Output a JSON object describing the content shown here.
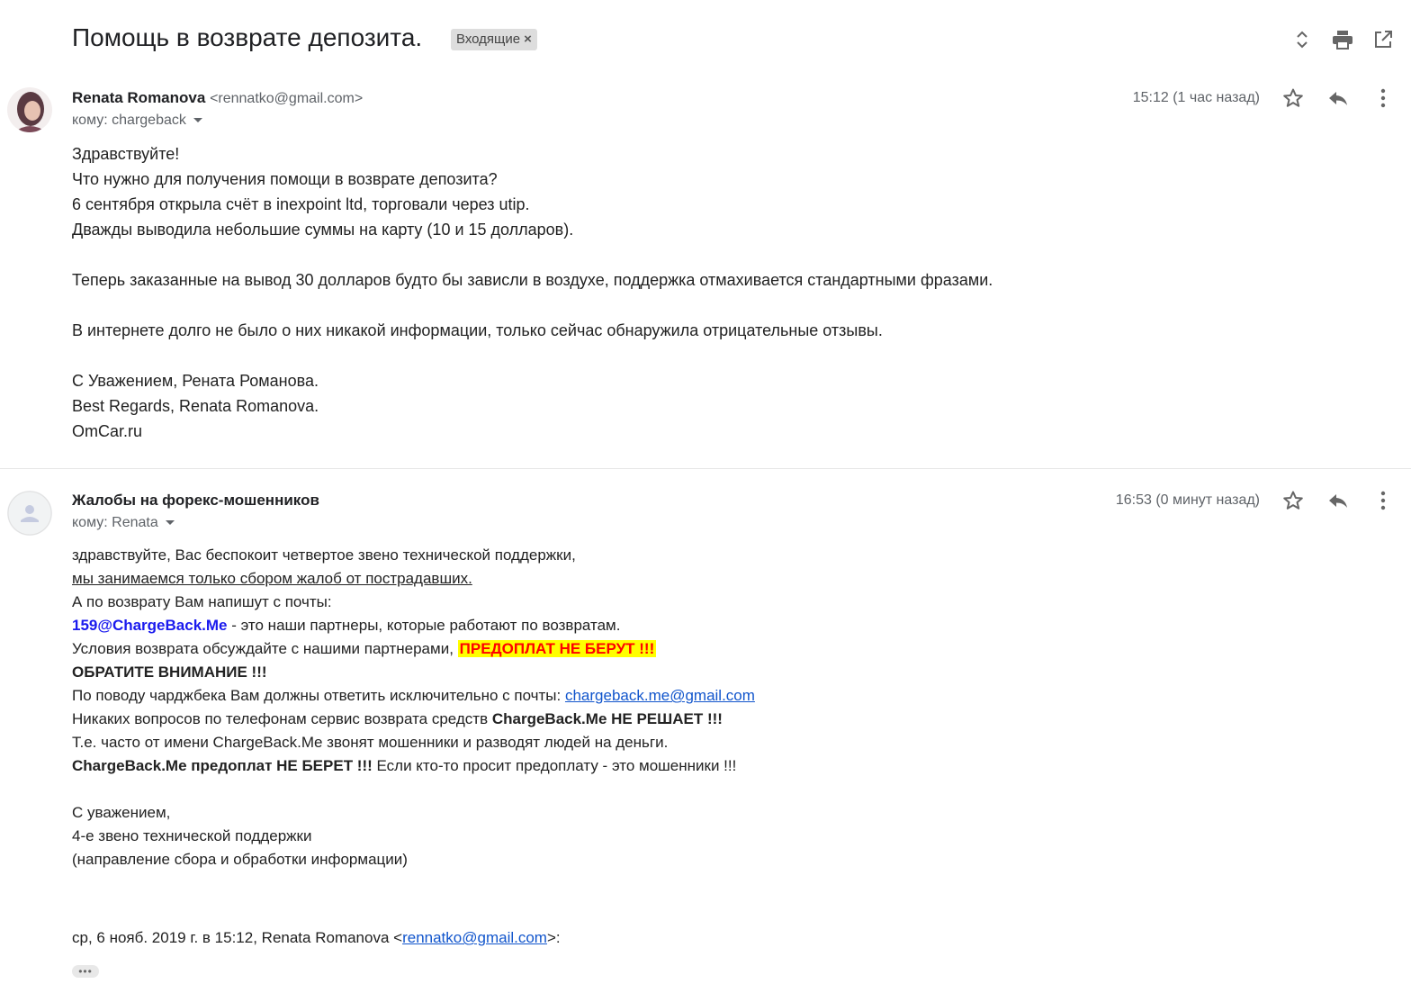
{
  "thread": {
    "subject": "Помощь в возврате депозита.",
    "label": "Входящие",
    "label_close": "×"
  },
  "toolbar_icons": [
    "expand-collapse-icon",
    "print-icon",
    "open-in-new-window-icon"
  ],
  "message1": {
    "sender_name": "Renata Romanova",
    "sender_email": "<rennatko@gmail.com>",
    "to": "кому: chargeback",
    "time": "15:12 (1 час назад)",
    "body": "Здравствуйте!\nЧто нужно для получения помощи в возврате депозита?\n6 сентября открыла счёт в inexpoint ltd, торговали через utip.\nДважды выводила небольшие суммы на карту (10 и 15 долларов).\n\nТеперь заказанные на вывод 30 долларов будто бы зависли в воздухе, поддержка отмахивается стандартными фразами.\n\nВ интернете долго не было о них никакой информации, только сейчас обнаружила отрицательные отзывы.\n\nС Уважением, Рената Романова.\nBest Regards, Renata Romanova.\nOmCar.ru"
  },
  "message2": {
    "sender_name": "Жалобы на форекс-мошенников",
    "to": "кому: Renata",
    "time": "16:53 (0 минут назад)",
    "line1": "здравствуйте, Вас беспокоит четвертое звено технической поддержки,",
    "line2": "мы занимаемся только сбором жалоб от пострадавших.",
    "line3": "А по возврату Вам напишут с почты:",
    "line4_email": "159@ChargeBack.Me",
    "line4_rest": " - это наши партнеры, которые работают по возвратам.",
    "line5_text": "Условия возврата обсуждайте с нашими партнерами, ",
    "line5_highlight": "ПРЕДОПЛАТ НЕ БЕРУТ !!!",
    "line6": "ОБРАТИТЕ ВНИМАНИЕ !!!",
    "line7_text": "По поводу чарджбека Вам должны ответить исключительно с почты: ",
    "line7_email": "chargeback.me@gmail.com",
    "line8_text": "Никаких вопросов по телефонам сервис возврата средств ",
    "line8_bold": "ChargeBack.Me НЕ РЕШАЕТ !!!",
    "line9": "Т.е. часто от имени ChargeBack.Me звонят мошенники и разводят людей на деньги.",
    "line10_bold": "ChargeBack.Me предоплат НЕ БЕРЕТ !!!",
    "line10_rest": " Если кто-то просит предоплату - это мошенники !!!",
    "sign1": "С уважением,",
    "sign2": "4-е звено технической поддержки",
    "sign3": "(направление сбора и обработки информации)",
    "quote_prefix": "ср, 6 нояб. 2019 г. в 15:12, Renata Romanova <",
    "quote_email": "rennatko@gmail.com",
    "quote_suffix": ">:",
    "trimmed": "•••"
  }
}
